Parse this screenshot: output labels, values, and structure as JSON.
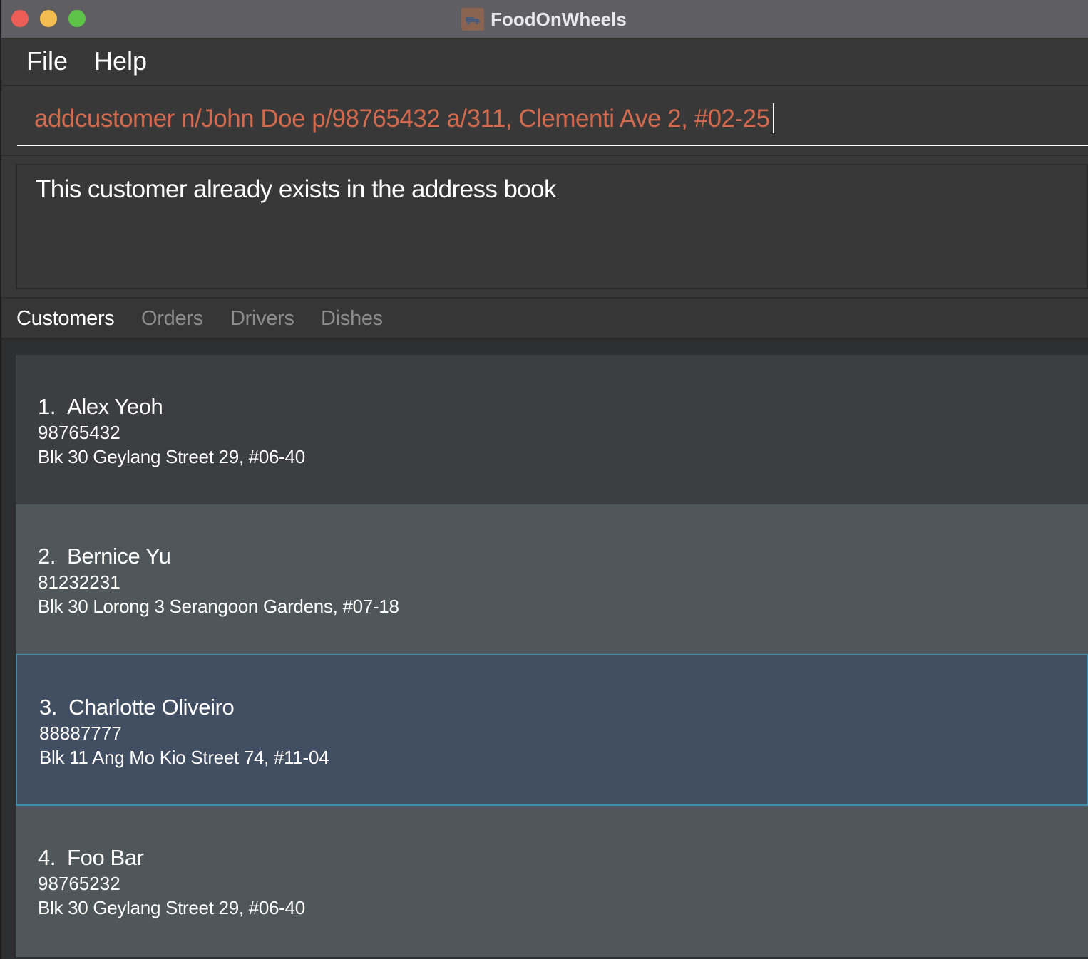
{
  "window": {
    "title": "FoodOnWheels",
    "icon": "delivery-truck-icon"
  },
  "menu": {
    "file": "File",
    "help": "Help"
  },
  "command": {
    "value": "addcustomer n/John Doe p/98765432 a/311, Clementi Ave 2, #02-25",
    "text_color": "#d16a4f"
  },
  "result": {
    "message": "This customer already exists in the address book"
  },
  "tabs": [
    {
      "label": "Customers",
      "active": true
    },
    {
      "label": "Orders",
      "active": false
    },
    {
      "label": "Drivers",
      "active": false
    },
    {
      "label": "Dishes",
      "active": false
    }
  ],
  "customers": [
    {
      "index": "1.",
      "name": "Alex Yeoh",
      "phone": "98765432",
      "address": "Blk 30 Geylang Street 29, #06-40"
    },
    {
      "index": "2.",
      "name": "Bernice Yu",
      "phone": "81232231",
      "address": "Blk 30 Lorong 3 Serangoon Gardens, #07-18"
    },
    {
      "index": "3.",
      "name": "Charlotte Oliveiro",
      "phone": "88887777",
      "address": "Blk 11 Ang Mo Kio Street 74, #11-04",
      "selected": true
    },
    {
      "index": "4.",
      "name": "Foo Bar",
      "phone": "98765232",
      "address": "Blk 30 Geylang Street 29, #06-40"
    }
  ],
  "colors": {
    "selection_border": "#3f8fb1",
    "selection_background": "#424e61"
  }
}
